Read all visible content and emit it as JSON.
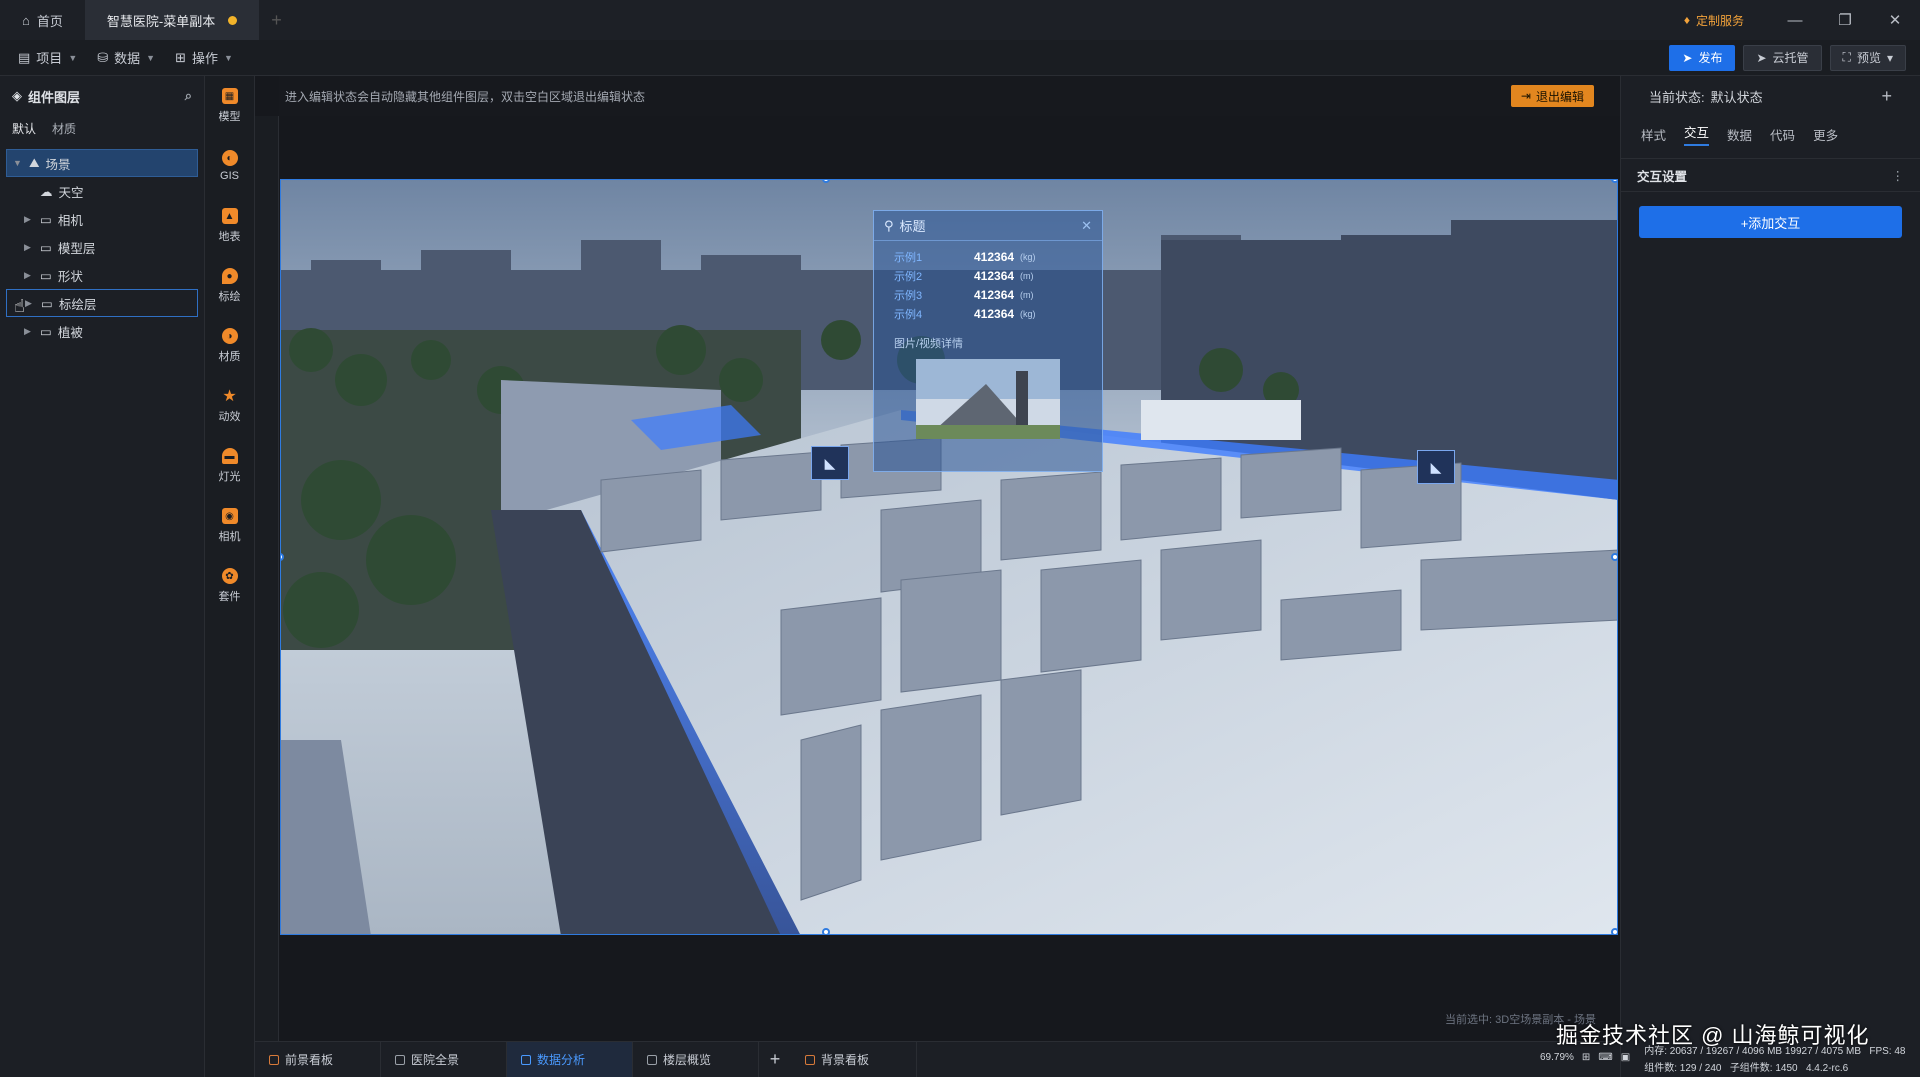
{
  "titlebar": {
    "tabs": [
      {
        "label": "首页"
      },
      {
        "label": "智慧医院-菜单副本"
      }
    ],
    "service_label": "定制服务"
  },
  "toolbar": {
    "menus": [
      {
        "label": "项目"
      },
      {
        "label": "数据"
      },
      {
        "label": "操作"
      }
    ],
    "publish_label": "发布",
    "cloud_label": "云托管",
    "preview_label": "预览"
  },
  "layers": {
    "title": "组件图层",
    "tabs": [
      "默认",
      "材质"
    ],
    "tree": [
      {
        "label": "场景",
        "icon": "scene-icon"
      },
      {
        "label": "天空",
        "icon": "sky-icon"
      },
      {
        "label": "相机",
        "icon": "folder-icon"
      },
      {
        "label": "模型层",
        "icon": "folder-icon"
      },
      {
        "label": "形状",
        "icon": "folder-icon"
      },
      {
        "label": "标绘层",
        "icon": "folder-icon"
      },
      {
        "label": "植被",
        "icon": "folder-icon"
      }
    ]
  },
  "iconbar": {
    "items": [
      {
        "label": "模型",
        "icon": "model-icon"
      },
      {
        "label": "GIS",
        "icon": "gis-icon"
      },
      {
        "label": "地表",
        "icon": "terrain-icon"
      },
      {
        "label": "标绘",
        "icon": "marker-icon"
      },
      {
        "label": "材质",
        "icon": "material-icon"
      },
      {
        "label": "动效",
        "icon": "effect-icon"
      },
      {
        "label": "灯光",
        "icon": "light-icon"
      },
      {
        "label": "相机",
        "icon": "camera-icon"
      },
      {
        "label": "套件",
        "icon": "kit-icon"
      }
    ]
  },
  "canvas": {
    "hint": "进入编辑状态会自动隐藏其他组件图层，双击空白区域退出编辑状态",
    "exit_label": "退出编辑",
    "current_selection": "当前选中: 3D空场景副本 - 场景"
  },
  "popup": {
    "title": "标题",
    "rows": [
      {
        "key": "示例1",
        "value": "412364",
        "unit": "(kg)"
      },
      {
        "key": "示例2",
        "value": "412364",
        "unit": "(m)"
      },
      {
        "key": "示例3",
        "value": "412364",
        "unit": "(m)"
      },
      {
        "key": "示例4",
        "value": "412364",
        "unit": "(kg)"
      }
    ],
    "media_label": "图片/视频详情"
  },
  "inspector": {
    "state_label": "当前状态:",
    "state_value": "默认状态",
    "tabs": [
      "样式",
      "交互",
      "数据",
      "代码",
      "更多"
    ],
    "section_title": "交互设置",
    "add_label": "+添加交互"
  },
  "bottom": {
    "tabs": [
      "前景看板",
      "医院全景",
      "数据分析",
      "楼层概览",
      "背景看板"
    ],
    "zoom": "69.79%",
    "memory": "内存: 20637 / 19267 / 4096 MB  19927 / 4075 MB",
    "fps": "FPS: 48",
    "components": "组件数: 129 / 240",
    "sub_components": "子组件数: 1450",
    "version": "4.4.2-rc.6"
  },
  "watermark": "掘金技术社区 @ 山海鲸可视化",
  "colors": {
    "accent": "#1e6fe8",
    "orange": "#e2861f",
    "panel": "#1c1f25"
  }
}
